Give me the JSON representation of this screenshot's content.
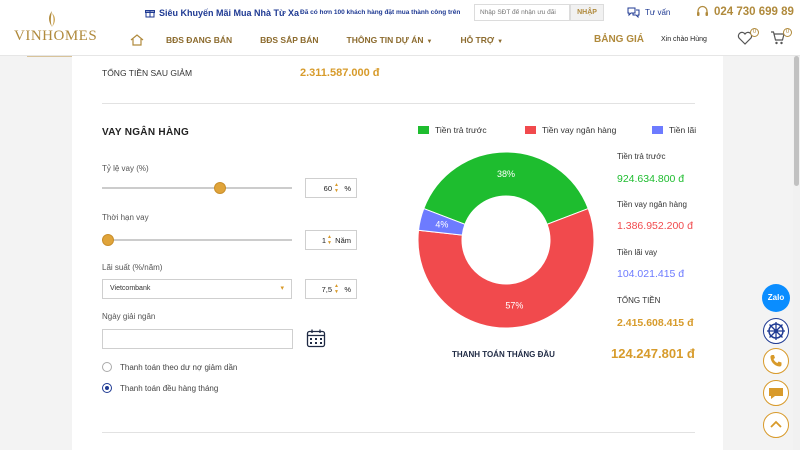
{
  "brand": {
    "name": "VINHOMES"
  },
  "topbar": {
    "promo": "Siêu Khuyến Mãi Mua Nhà Từ Xa",
    "ticker": "Đã có hơn 100 khách hàng đặt mua thành công trên",
    "phone_placeholder": "Nhập SĐT để nhận ưu đãi",
    "submit_label": "NHẬP",
    "advice_label": "Tư vấn",
    "hotline": "024 730 699 89"
  },
  "nav": {
    "items": [
      "BĐS ĐANG BÁN",
      "BĐS SẮP BÁN",
      "THÔNG TIN DỰ ÁN",
      "HỖ TRỢ"
    ],
    "price_board": "BẢNG GIÁ",
    "greeting": "Xin chào Hùng",
    "wishlist_count": "0",
    "cart_count": "0"
  },
  "summary_top": {
    "label": "TỔNG TIỀN SAU GIẢM",
    "value": "2.311.587.000 đ"
  },
  "loan": {
    "title": "VAY NGÂN HÀNG",
    "ratio_label": "Tỷ lệ vay (%)",
    "ratio_value": "60",
    "ratio_unit": "%",
    "ratio_slider": 0.6,
    "term_label": "Thời hạn vay",
    "term_value": "1",
    "term_unit": "Năm",
    "term_slider": 0.0,
    "rate_label": "Lãi suất (%/năm)",
    "bank": "Vietcombank",
    "rate_value": "7,5",
    "rate_unit": "%",
    "disburse_label": "Ngày giải ngân",
    "radio_options": [
      "Thanh toán theo dư nợ giảm dần",
      "Thanh toán đều hàng tháng"
    ],
    "radio_selected": 1
  },
  "chart_data": {
    "type": "pie",
    "donut": true,
    "categories": [
      "Tiền trả trước",
      "Tiền vay ngân hàng",
      "Tiền lãi"
    ],
    "values": [
      38,
      57,
      4
    ],
    "labels": [
      "38%",
      "57%",
      "4%"
    ],
    "colors": [
      "#1ebd2f",
      "#f14a4d",
      "#6d7bff"
    ],
    "legend_position": "top"
  },
  "results": {
    "down_label": "Tiền trả trước",
    "down_value": "924.634.800 đ",
    "loan_label": "Tiền vay ngân hàng",
    "loan_value": "1.386.952.200 đ",
    "interest_label": "Tiền lãi vay",
    "interest_value": "104.021.415 đ",
    "total_label": "TỔNG TIỀN",
    "total_value": "2.415.608.415 đ",
    "monthly_label": "THANH TOÁN THÁNG ĐẦU",
    "monthly_value": "124.247.801 đ"
  },
  "colors": {
    "gold": "#d79b2b",
    "navy": "#1f3a93",
    "green": "#1ebd2f",
    "red": "#f14a4d",
    "blue": "#6d7bff"
  },
  "side": {
    "zalo_label": "Zalo"
  },
  "icons": [
    "home-icon",
    "gift-icon",
    "headset-icon",
    "phone-icon",
    "heart-icon",
    "cart-icon",
    "calendar-icon",
    "phone-call-icon",
    "chat-icon",
    "chevron-up-icon",
    "helm-icon"
  ]
}
